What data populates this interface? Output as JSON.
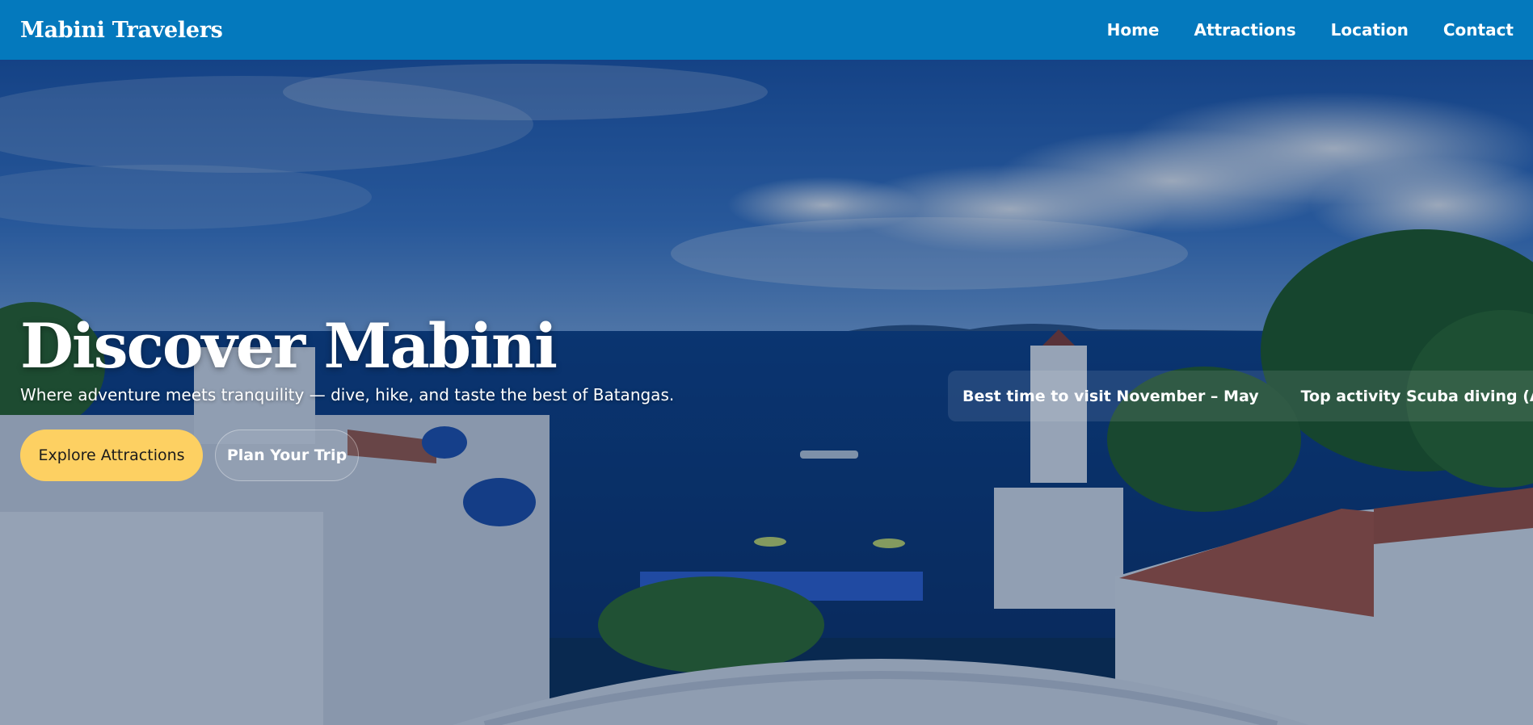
{
  "header": {
    "brand": "Mabini Travelers",
    "nav": [
      "Home",
      "Attractions",
      "Location",
      "Contact"
    ]
  },
  "hero": {
    "title": "Discover Mabini",
    "subtitle": "Where adventure meets tranquility — dive, hike, and taste the best of Batangas.",
    "primary_button": "Explore Attractions",
    "secondary_button": "Plan Your Trip",
    "highlights": [
      "Best time to visit November – May",
      "Top activity Scuba diving (Anilao)"
    ]
  },
  "colors": {
    "header": "#0479bd",
    "accent": "#fdd062"
  },
  "icons": []
}
